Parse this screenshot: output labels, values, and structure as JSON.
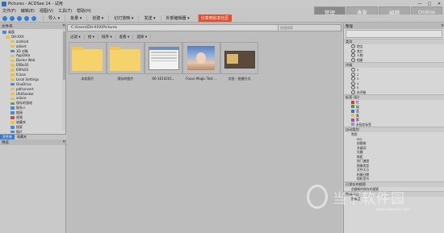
{
  "window": {
    "title": "Pictures - ACDSee 14 - 试用",
    "controls": [
      "—",
      "□",
      "✕"
    ]
  },
  "menu": [
    "文件(F)",
    "编辑(E)",
    "视图(V)",
    "工具(T)",
    "帮助(H)"
  ],
  "mode_tabs": [
    "管理",
    "查看",
    "编辑",
    "Online"
  ],
  "toolbar": {
    "items": [
      "导入 ▾",
      "批量 ▾",
      "创建 ▾",
      "幻灯放映 ▾",
      "发送 ▾",
      "外部编辑器 ▾"
    ],
    "share_button": "分享到好友社区"
  },
  "left_pane": {
    "header": "文件夹",
    "tree": [
      {
        "label": "桌面",
        "color": "blue"
      },
      {
        "label": "DH-XXX",
        "color": "yellow"
      },
      {
        "label": "android",
        "color": "yellow"
      },
      {
        "label": "asbert",
        "color": "yellow"
      },
      {
        "label": "3D 对象",
        "color": "blue"
      },
      {
        "label": "AppData",
        "color": "yellow"
      },
      {
        "label": "Doctor Web",
        "color": "yellow"
      },
      {
        "label": "ERBoSS",
        "color": "yellow"
      },
      {
        "label": "ERPoSS",
        "color": "yellow"
      },
      {
        "label": "fcinan",
        "color": "yellow"
      },
      {
        "label": "Local Settings",
        "color": "yellow"
      },
      {
        "label": "OneDrive",
        "color": "blue"
      },
      {
        "label": "pdfconvert",
        "color": "yellow"
      },
      {
        "label": "UIUISeeker",
        "color": "yellow"
      },
      {
        "label": "xstore",
        "color": "yellow"
      },
      {
        "label": "保存的游戏",
        "color": "green"
      },
      {
        "label": "联系人",
        "color": "blue"
      },
      {
        "label": "链接",
        "color": "blue"
      },
      {
        "label": "视频",
        "color": "red"
      },
      {
        "label": "收藏夹",
        "color": "yellow"
      },
      {
        "label": "搜索",
        "color": "blue"
      },
      {
        "label": "图片",
        "color": "blue"
      }
    ],
    "tabs": [
      "文件夹",
      "收藏夹"
    ],
    "preview_header": "预览"
  },
  "path_bar": {
    "path": "C:\\Users\\DH-XXX\\Pictures",
    "search_placeholder": "快速搜索"
  },
  "filter_bar": [
    "过滤 ▾",
    "组 ▾",
    "排序 ▾",
    "查看 ▾",
    "选择 ▾"
  ],
  "files": [
    {
      "caption": "本机照片",
      "kind": "folder"
    },
    {
      "caption": "保存的图片",
      "kind": "folder"
    },
    {
      "caption": "66-1610201...",
      "kind": "screenshot"
    },
    {
      "caption": "Focus Magic Test ...",
      "kind": "photo"
    },
    {
      "caption": "文档 - 快捷方式",
      "kind": "doc"
    }
  ],
  "right_pane": {
    "header": "整理",
    "sections": [
      {
        "title": "类别",
        "items": [
          "地点",
          "其它",
          "人物",
          "相册"
        ],
        "marker": "radio"
      },
      {
        "title": "评级",
        "items": [
          "1",
          "2",
          "3",
          "4",
          "5",
          "未评级"
        ],
        "marker": "radio"
      },
      {
        "title": "标签 (彩)",
        "items": [
          "红",
          "绿",
          "蓝",
          "黄",
          "紫",
          "未指定标签"
        ],
        "marker": "swatch"
      },
      {
        "title": "自动类别",
        "items": [
          "常用",
          "ISO",
          "创建者",
          "关键词",
          "光圈",
          "焦距",
          "快门速度",
          "图像类型",
          "文件大小",
          "拍摄日期",
          "相机型号"
        ],
        "marker": "tree"
      },
      {
        "title": "已保存的搜索",
        "items": [
          "创建新的保存的搜索"
        ],
        "marker": "none"
      },
      {
        "title": "特殊项目",
        "items": [
          "图像篮"
        ],
        "marker": "none"
      }
    ],
    "swatch_colors": [
      "#d43a3a",
      "#3aa04a",
      "#3a6fd4",
      "#e4c43a",
      "#9a4ad4",
      "#9a9a9a"
    ]
  },
  "watermark": {
    "text": "当下软件园",
    "sub": "www.downxia.com"
  }
}
